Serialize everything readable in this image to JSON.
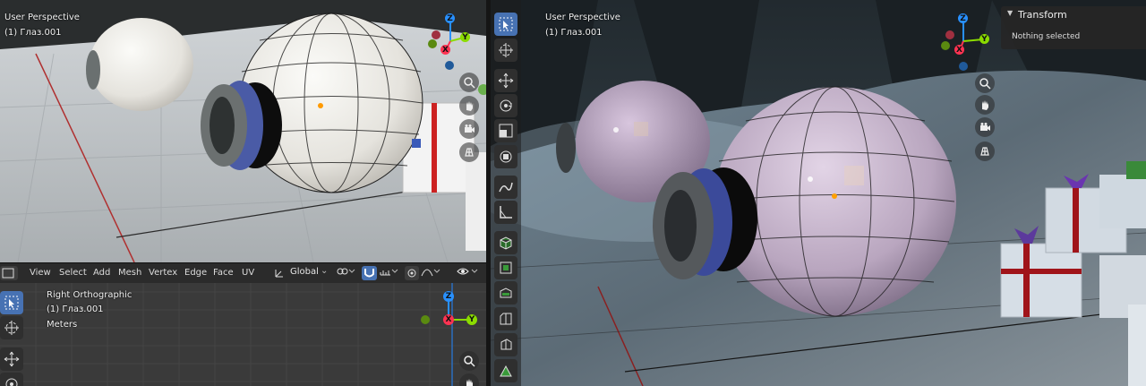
{
  "left_viewport": {
    "view_label": "User Perspective",
    "object_label": "(1) Глаз.001"
  },
  "header": {
    "menus": [
      "View",
      "Select",
      "Add",
      "Mesh",
      "Vertex",
      "Edge",
      "Face",
      "UV"
    ],
    "transform_orientation": "Global"
  },
  "ortho_viewport": {
    "view_label": "Right Orthographic",
    "object_label": "(1) Глаз.001",
    "units_label": "Meters"
  },
  "right_viewport": {
    "view_label": "User Perspective",
    "object_label": "(1) Глаз.001"
  },
  "transform_panel": {
    "title": "Transform",
    "message": "Nothing selected"
  },
  "gizmo": {
    "x": "X",
    "y": "Y",
    "z": "Z"
  },
  "colors": {
    "active_tool": "#4772b3",
    "axis_x": "#ff3352",
    "axis_y": "#8bdc00",
    "axis_z": "#2890ff"
  },
  "icons": {
    "tools": [
      "select-icon",
      "cursor-icon",
      "move-icon",
      "rotate-icon",
      "scale-icon",
      "transform-icon",
      "annotate-icon",
      "measure-icon",
      "add-cube-icon",
      "extrude-icon",
      "inset-icon",
      "bevel-icon",
      "loopcut-icon",
      "knife-icon"
    ],
    "navigation": [
      "zoom-icon",
      "hand-icon",
      "camera-icon",
      "grid-icon"
    ]
  }
}
